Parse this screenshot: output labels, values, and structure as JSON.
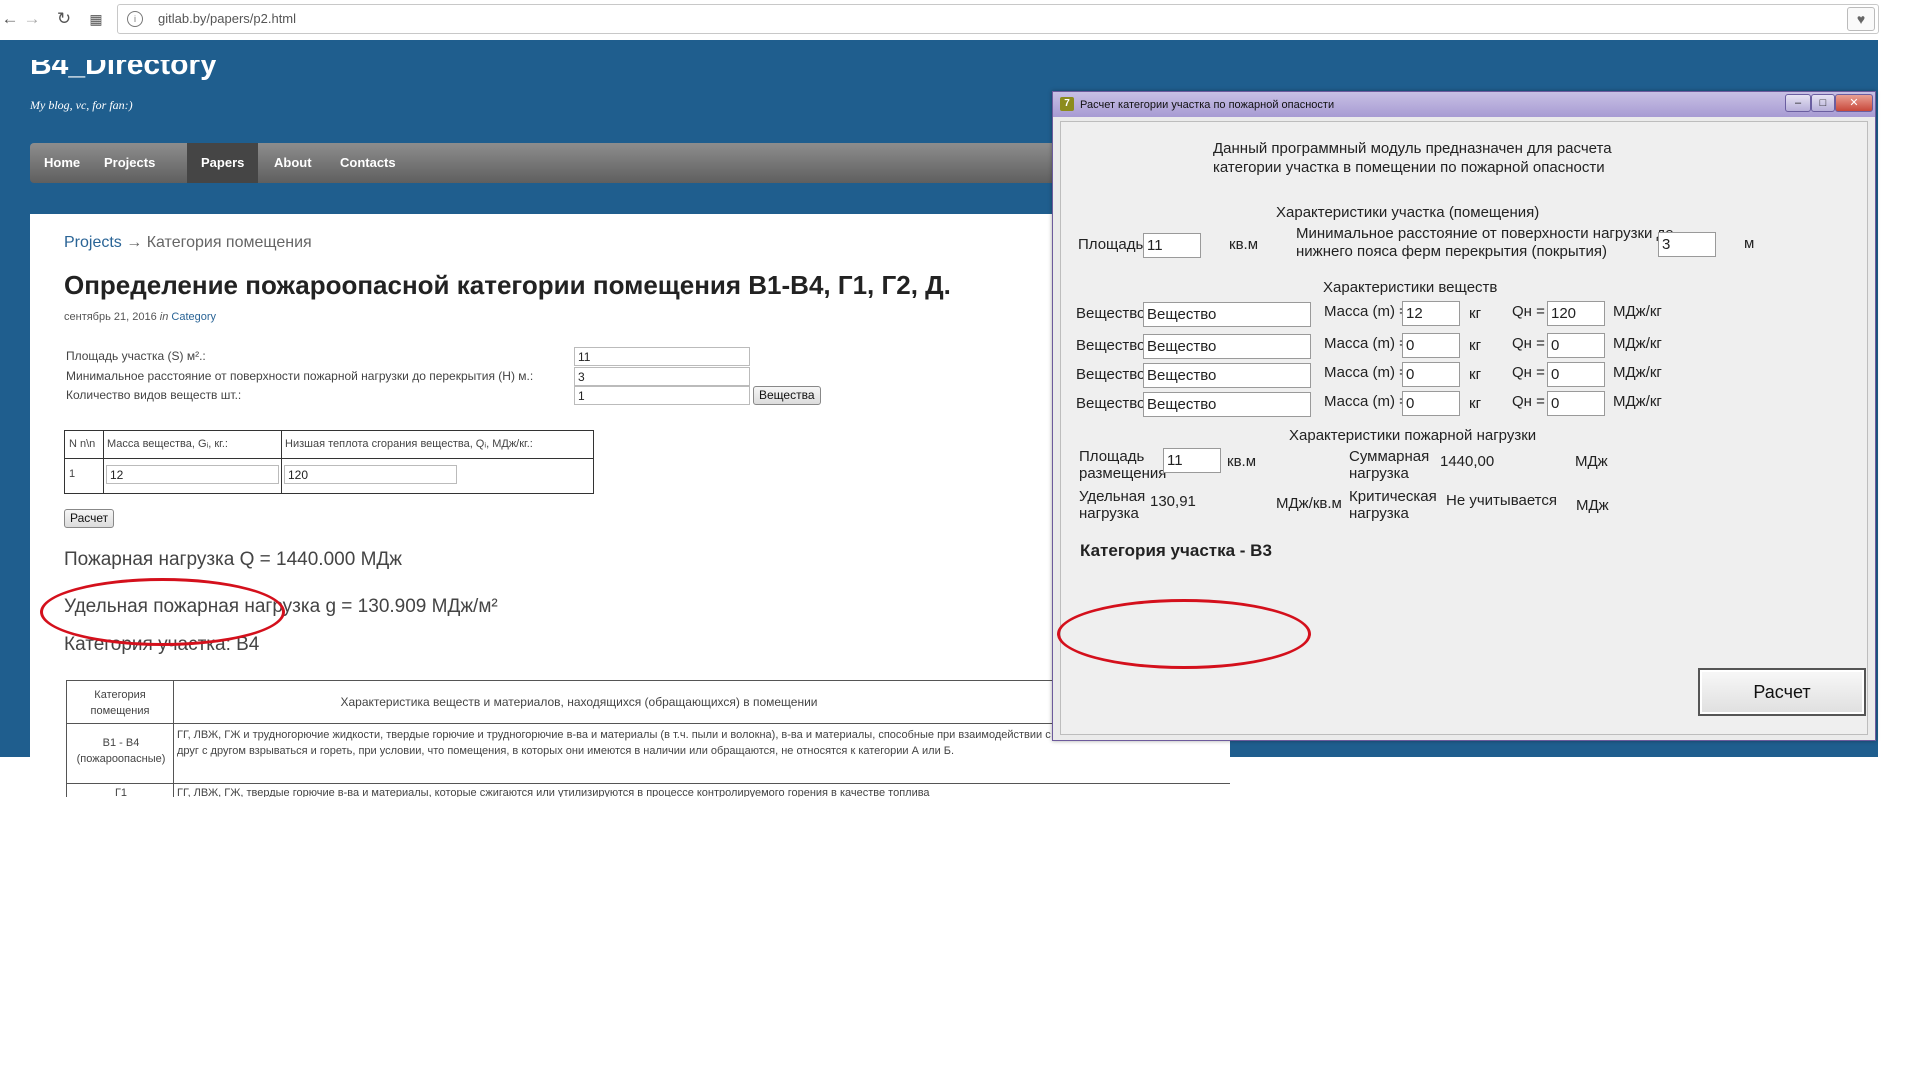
{
  "browser": {
    "url": "gitlab.by/papers/p2.html",
    "back_icon": "arrow-left-icon",
    "forward_icon": "arrow-right-icon",
    "reload_icon": "reload-icon",
    "apps_icon": "apps-grid-icon",
    "bookmark_icon": "heart-icon"
  },
  "site": {
    "title": "B4_Directory",
    "tagline": "My blog, vc, for fan:)",
    "nav": [
      "Home",
      "Projects",
      "Papers",
      "About",
      "Contacts"
    ],
    "active_nav": "Papers"
  },
  "article": {
    "breadcrumb_link": "Projects",
    "breadcrumb_rest": " → Категория помещения",
    "title": "Определение пожароопасной категории помещения В1-В4, Г1, Г2, Д.",
    "meta_date": "сентябрь 21, 2016",
    "meta_in": " in ",
    "meta_category": "Category",
    "fields": [
      {
        "label": "Площадь участка (S) м².:",
        "value": "11"
      },
      {
        "label": "Минимальное расстояние от поверхности пожарной нагрузки до перекрытия (H) м.:",
        "value": "3"
      },
      {
        "label": "Количество видов веществ шт.:",
        "value": "1"
      }
    ],
    "substances_button": "Вещества",
    "table_headers": [
      "N n\\n",
      "Масса вещества, Gᵢ, кг.:",
      "Низшая теплота сгорания вещества, Qᵢ, МДж/кг.:"
    ],
    "table_row": {
      "n": "1",
      "mass": "12",
      "heat": "120"
    },
    "calc_button": "Расчет",
    "fire_load": "Пожарная нагрузка Q = 1440.000 МДж",
    "specific_load": "Удельная пожарная нагрузка g = 130.909 МДж/м²",
    "category_result": "Категория участка: В4",
    "category_table": {
      "headers": [
        "Категория помещения",
        "Характеристика веществ и материалов, находящихся (обращающихся) в помещении"
      ],
      "row1_category": "В1 - В4 (пожароопасные)",
      "row1_text": "ГГ, ЛВЖ, ГЖ и трудногорючие жидкости, твердые горючие и трудногорючие в-ва и материалы (в т.ч. пыли и волокна), в-ва и материалы, способные при взаимодействии с водой, кислородом воздуха или друг с другом взрываться и гореть, при условии, что помещения, в которых они имеются в наличии или обращаются, не относятся к категории А или Б.",
      "row2_category": "Г1",
      "row2_text": "ГГ, ЛВЖ, ГЖ, твердые горючие в-ва и материалы, которые сжигаются или утилизируются в процессе контролируемого горения в качестве топлива"
    }
  },
  "dialog": {
    "title": "Расчет категории участка по пожарной опасности",
    "buttons": [
      "minimize-icon",
      "maximize-icon",
      "close-icon"
    ],
    "intro": [
      "Данный программный модуль предназначен для расчета",
      "категории участка в помещении по пожарной опасности"
    ],
    "section_room": "Характеристики участка (помещения)",
    "area_label": "Площадь",
    "area_value": "11",
    "area_unit": "кв.м",
    "distance_label": [
      "Минимальное расстояние от поверхности нагрузки до",
      "нижнего пояса ферм перекрытия (покрытия)"
    ],
    "distance_value": "3",
    "distance_unit": "м",
    "section_substances": "Характеристики веществ",
    "substances": [
      {
        "label": "Вещество",
        "name": "Вещество",
        "mass_label": "Масса (m) =",
        "mass": "12",
        "mass_unit": "кг",
        "q_label": "Qн =",
        "q": "120",
        "q_unit": "МДж/кг"
      },
      {
        "label": "Вещество",
        "name": "Вещество",
        "mass_label": "Масса (m) =",
        "mass": "0",
        "mass_unit": "кг",
        "q_label": "Qн =",
        "q": "0",
        "q_unit": "МДж/кг"
      },
      {
        "label": "Вещество",
        "name": "Вещество",
        "mass_label": "Масса (m) =",
        "mass": "0",
        "mass_unit": "кг",
        "q_label": "Qн =",
        "q": "0",
        "q_unit": "МДж/кг"
      },
      {
        "label": "Вещество",
        "name": "Вещество",
        "mass_label": "Масса (m) =",
        "mass": "0",
        "mass_unit": "кг",
        "q_label": "Qн =",
        "q": "0",
        "q_unit": "МДж/кг"
      }
    ],
    "section_fireload": "Характеристики пожарной нагрузки",
    "placement_label": [
      "Площадь",
      "размещения"
    ],
    "placement_value": "11",
    "placement_unit": "кв.м",
    "total_label": [
      "Суммарная",
      "нагрузка"
    ],
    "total_value": "1440,00",
    "total_unit": "МДж",
    "specific_label": [
      "Удельная",
      "нагрузка"
    ],
    "specific_value": "130,91",
    "specific_unit": "МДж/кв.м",
    "critical_label": [
      "Критическая",
      "нагрузка"
    ],
    "critical_value": "Не учитывается",
    "critical_unit": "МДж",
    "category_result": "Категория участка - В3",
    "calc_button": "Расчет"
  },
  "colors": {
    "page_bg": "#1f5e8e",
    "annotation": "#d4101c",
    "dialog_title": "#a79bd3"
  }
}
